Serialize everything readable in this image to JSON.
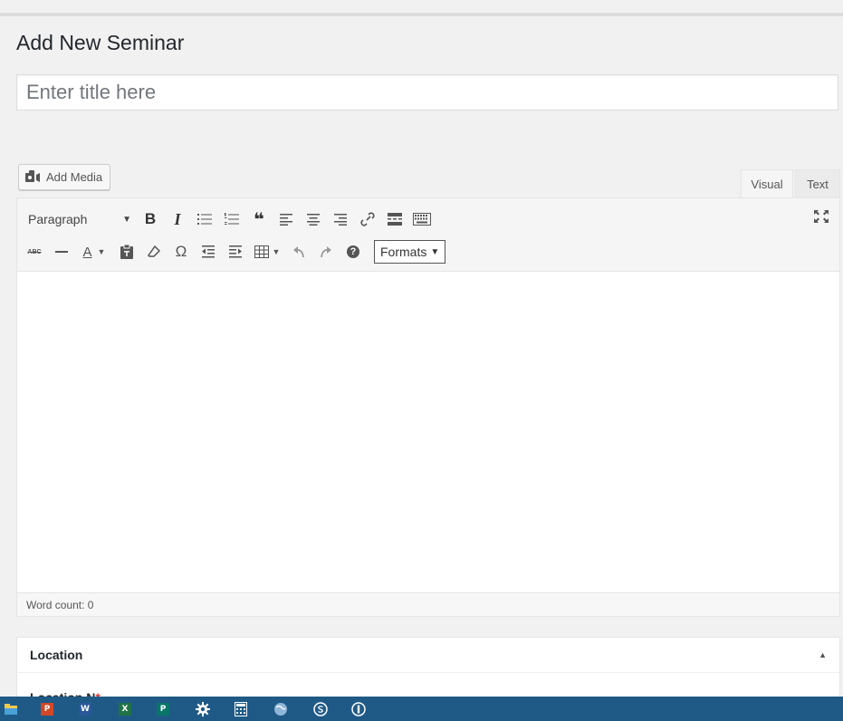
{
  "page": {
    "title": "Add New Seminar"
  },
  "title_field": {
    "placeholder": "Enter title here",
    "value": ""
  },
  "media": {
    "add_media_label": "Add Media"
  },
  "editor": {
    "tabs": [
      {
        "label": "Visual",
        "active": true
      },
      {
        "label": "Text",
        "active": false
      }
    ],
    "format_select": "Paragraph",
    "formats_label": "Formats",
    "row1_buttons": [
      "bold-icon",
      "italic-icon",
      "bulleted-list-icon",
      "numbered-list-icon",
      "blockquote-icon",
      "align-left-icon",
      "align-center-icon",
      "align-right-icon",
      "link-icon",
      "read-more-icon",
      "toolbar-toggle-icon"
    ],
    "row2_buttons": [
      "strikethrough-icon",
      "horizontal-line-icon",
      "text-color-icon",
      "paste-as-text-icon",
      "clear-formatting-icon",
      "special-character-icon",
      "decrease-indent-icon",
      "increase-indent-icon",
      "table-icon",
      "undo-icon",
      "redo-icon",
      "help-icon"
    ],
    "glyphs": {
      "bold": "B",
      "italic": "I",
      "quote": "❝",
      "omega": "Ω",
      "help": "?",
      "abc": "ABC",
      "text_color": "A"
    },
    "word_count": "Word count: 0"
  },
  "metabox": {
    "title": "Location",
    "field_label": "Location N",
    "required_mark": "*"
  },
  "taskbar": {
    "apps": [
      "file-explorer-icon",
      "powerpoint-icon",
      "word-icon",
      "excel-icon",
      "publisher-icon",
      "settings-icon",
      "calculator-icon",
      "globe-icon",
      "skype-icon",
      "onepassword-icon"
    ],
    "letters": {
      "powerpoint": "P",
      "word": "W",
      "excel": "X",
      "publisher": "P"
    }
  },
  "colors": {
    "taskbar": "#1f5a87",
    "background": "#f1f1f1",
    "required": "#dc3232"
  }
}
